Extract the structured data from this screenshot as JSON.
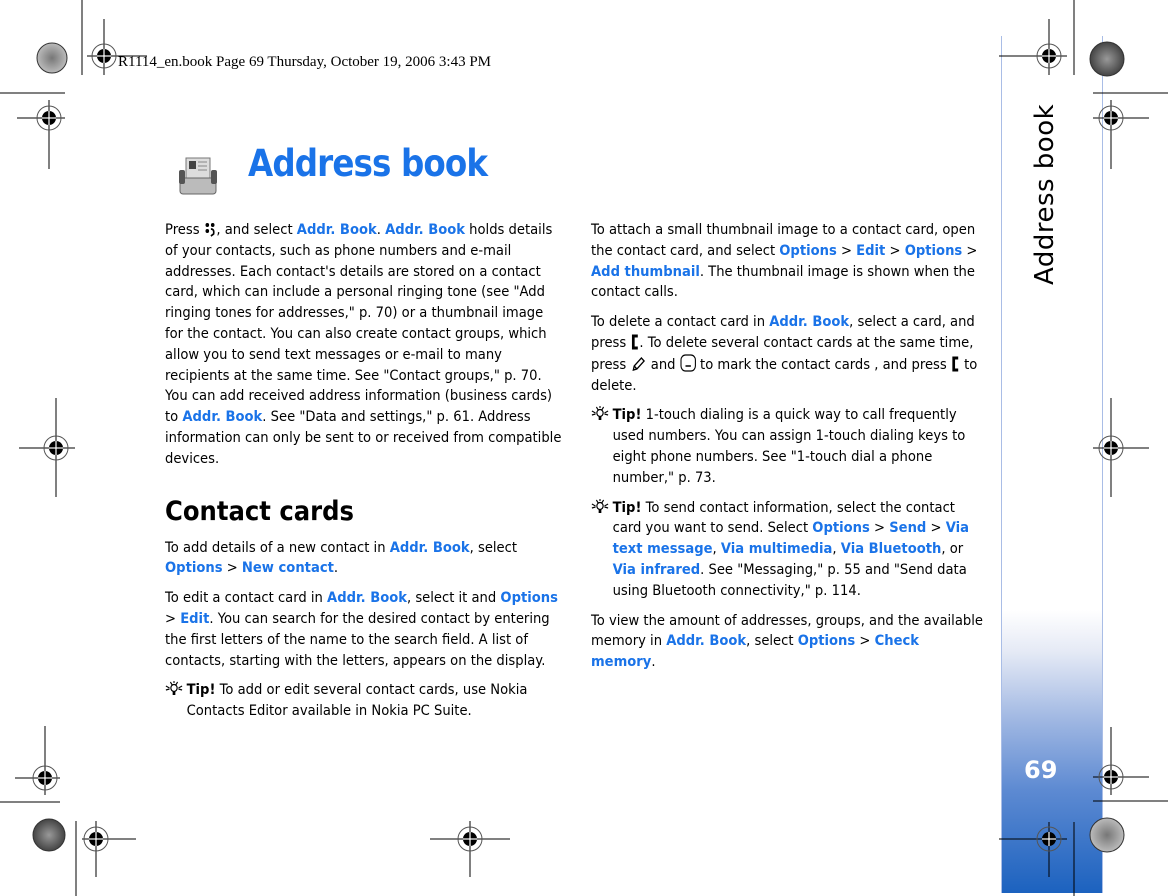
{
  "print_header": "R1114_en.book  Page 69  Thursday, October 19, 2006  3:43 PM",
  "page_title": "Address book",
  "side_tab": {
    "label": "Address book",
    "page_number": "69"
  },
  "colors": {
    "accent": "#1a73e8",
    "tab_gradient_bottom": "#1c62bf",
    "tab_border": "#a9bde6"
  },
  "icons": [
    "address-book-icon",
    "menu-key-icon",
    "clear-key-icon",
    "edit-key-icon",
    "navi-key-icon",
    "tip-lightbulb-icon",
    "registration-mark-icon",
    "color-wheel-icon"
  ],
  "col1": {
    "intro": {
      "t1": "Press ",
      "t2": ", and select ",
      "l1": "Addr. Book",
      "t3": ". ",
      "l2": "Addr. Book",
      "t4": " holds details of your contacts, such as phone numbers and e-mail addresses. Each contact's details are stored on a contact card, which can include a personal ringing tone (see \"Add ringing tones for addresses,\" p. 70) or a thumbnail image for the contact. You can also create contact groups, which allow you to send text messages or e-mail to many recipients at the same time. See \"Contact groups,\" p. 70. You can add received address information (business cards) to ",
      "l3": "Addr. Book",
      "t5": ". See \"Data and settings,\" p. 61. Address information can only be sent to or received from compatible devices."
    },
    "heading": "Contact cards",
    "p_add": {
      "t1": "To add details of a new contact in ",
      "l1": "Addr. Book",
      "t2": ", select ",
      "l2": "Options",
      "t3": " > ",
      "l3": "New contact",
      "t4": "."
    },
    "p_edit": {
      "t1": "To edit a contact card in ",
      "l1": "Addr. Book",
      "t2": ", select it and ",
      "l2": "Options",
      "t3": " > ",
      "l3": "Edit",
      "t4": ". You can search for the desired contact by entering the first letters of the name to the search field. A list of contacts, starting with the letters, appears on the display."
    },
    "tip": {
      "label": "Tip!",
      "text": " To add or edit several contact cards, use Nokia Contacts Editor available in Nokia PC Suite."
    }
  },
  "col2": {
    "p_thumb": {
      "t1": "To attach a small thumbnail image to a contact card, open the contact card, and select ",
      "l1": "Options",
      "t2": " > ",
      "l2": "Edit",
      "t3": " > ",
      "l3": "Options",
      "t4": " > ",
      "l4": "Add thumbnail",
      "t5": ". The thumbnail image is shown when the contact calls."
    },
    "p_delete": {
      "t1": "To delete a contact card in ",
      "l1": "Addr. Book",
      "t2": ", select a card, and press ",
      "t3": ". To delete several contact cards at the same time, press ",
      "t4": " and ",
      "t5": " to mark the contact cards , and press ",
      "t6": " to delete."
    },
    "tip1": {
      "label": "Tip!",
      "text": " 1-touch dialing is a quick way to call frequently used numbers. You can assign 1-touch dialing keys to eight phone numbers. See \"1-touch dial a phone number,\" p. 73."
    },
    "tip2": {
      "label": "Tip!",
      "t1": " To send contact information, select the contact card you want to send. Select ",
      "l1": "Options",
      "t2": " > ",
      "l2": "Send",
      "t3": " > ",
      "l3": "Via text message",
      "t4": ", ",
      "l4": "Via multimedia",
      "t5": ", ",
      "l5": "Via Bluetooth",
      "t6": ", or ",
      "l6": "Via infrared",
      "t7": ". See \"Messaging,\" p. 55 and \"Send data using Bluetooth connectivity,\" p. 114."
    },
    "p_memory": {
      "t1": "To view the amount of addresses, groups, and the available memory in ",
      "l1": "Addr. Book",
      "t2": ", select ",
      "l2": "Options",
      "t3": " > ",
      "l3": "Check memory",
      "t4": "."
    }
  }
}
